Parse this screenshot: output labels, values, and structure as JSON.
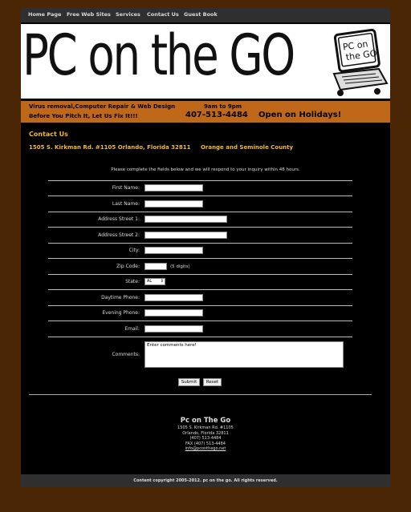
{
  "nav": {
    "items": [
      "Home Page",
      "Free Web Sites",
      "Services",
      "Contact Us",
      "Guest Book"
    ]
  },
  "banner": {
    "logo_text": "PC on the GO",
    "monitor_text_1": "PC on",
    "monitor_text_2": "the GO"
  },
  "stripe": {
    "line1_left": "Virus removal,Computer Repair & Web Design",
    "line1_right": "9am to 9pm",
    "line2_left": "Before You Pitch It, Let Us Fix It!!!",
    "phone": "407-513-4484",
    "holidays": "Open on Holidays!"
  },
  "contact": {
    "heading": "Contact Us",
    "address": "1505 S. Kirkman Rd. #1105 Orlando, Florida 32811",
    "county": "Orange and Seminole County",
    "intro": "Please complete the fields below and we will respond to your inquiry within 48 hours."
  },
  "form": {
    "first_name": "First Name:",
    "last_name": "Last Name:",
    "address1": "Address Street 1:",
    "address2": "Address Street 2:",
    "city": "City:",
    "zip": "Zip Code:",
    "zip_hint": "(5 digits)",
    "state": "State:",
    "state_value": "AL",
    "day_phone": "Daytime Phone:",
    "eve_phone": "Evening Phone:",
    "email": "Email:",
    "comments": "Comments:",
    "comments_value": "Enter comments here!",
    "submit": "Submit",
    "reset": "Reset"
  },
  "footer": {
    "name": "Pc on The Go",
    "street": "1505 S. Kirkman Rd. #1105",
    "city": "Orlando, Florida 32811",
    "phone": "(407) 513-4484",
    "fax": "FAX (407) 513-4484",
    "email": "info@pconthego.net",
    "copyright": "Content copyright 2005-2012. pc on the go. All rights reserved."
  },
  "colors": {
    "outer_background": "#4a2605",
    "stripe": "#c0681a",
    "accent_text": "#f0b83a",
    "nav_bar": "#2f2f2f"
  }
}
